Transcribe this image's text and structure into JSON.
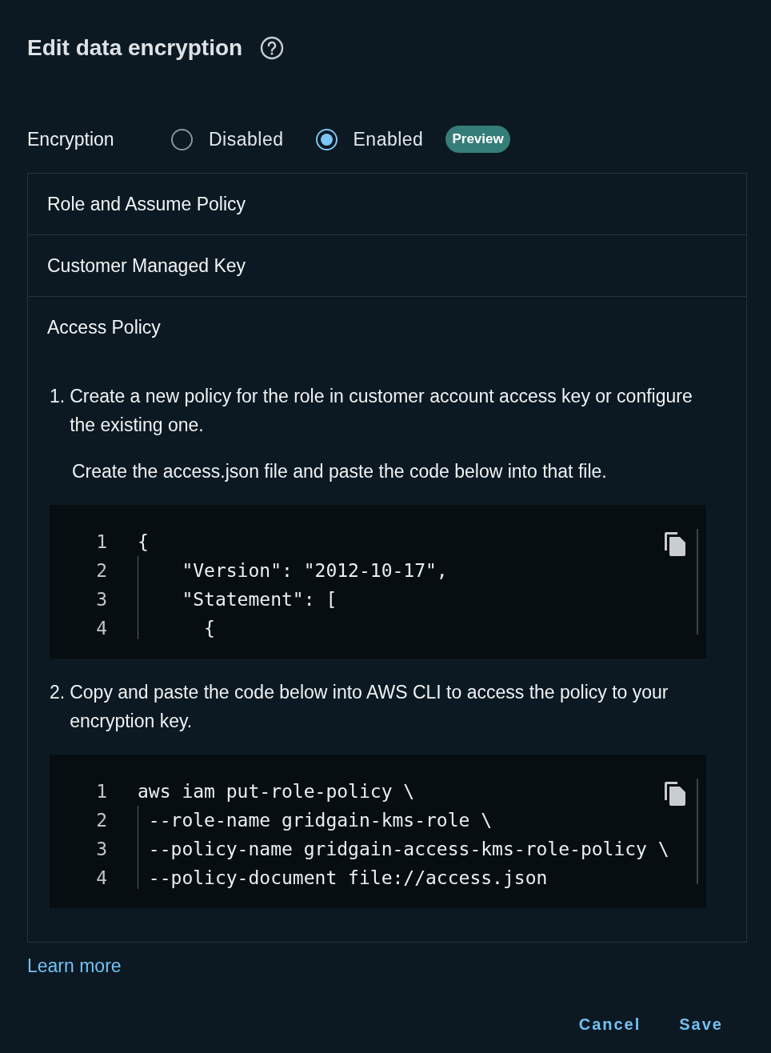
{
  "dialog": {
    "title": "Edit data encryption"
  },
  "encryption": {
    "label": "Encryption",
    "options": [
      {
        "label": "Disabled",
        "selected": false
      },
      {
        "label": "Enabled",
        "selected": true
      }
    ],
    "badge": "Preview"
  },
  "sections": [
    {
      "title": "Role and Assume Policy"
    },
    {
      "title": "Customer Managed Key"
    },
    {
      "title": "Access Policy",
      "steps": [
        {
          "number": "1.",
          "text": "Create a new policy for the role in customer account access key or configure the existing one.",
          "note": "Create the access.json file and paste the code below into that file.",
          "code": [
            {
              "number": "1",
              "text": "{"
            },
            {
              "number": "2",
              "text": "    \"Version\": \"2012-10-17\","
            },
            {
              "number": "3",
              "text": "    \"Statement\": ["
            },
            {
              "number": "4",
              "text": "      {"
            }
          ]
        },
        {
          "number": "2.",
          "text": "Copy and paste the code below into AWS CLI to access the policy to your encryption key.",
          "code": [
            {
              "number": "1",
              "text": "aws iam put-role-policy \\"
            },
            {
              "number": "2",
              "text": " --role-name gridgain-kms-role \\"
            },
            {
              "number": "3",
              "text": " --policy-name gridgain-access-kms-role-policy \\"
            },
            {
              "number": "4",
              "text": " --policy-document file://access.json"
            }
          ]
        }
      ]
    }
  ],
  "learn_more": "Learn more",
  "buttons": [
    "Cancel",
    "Save"
  ]
}
